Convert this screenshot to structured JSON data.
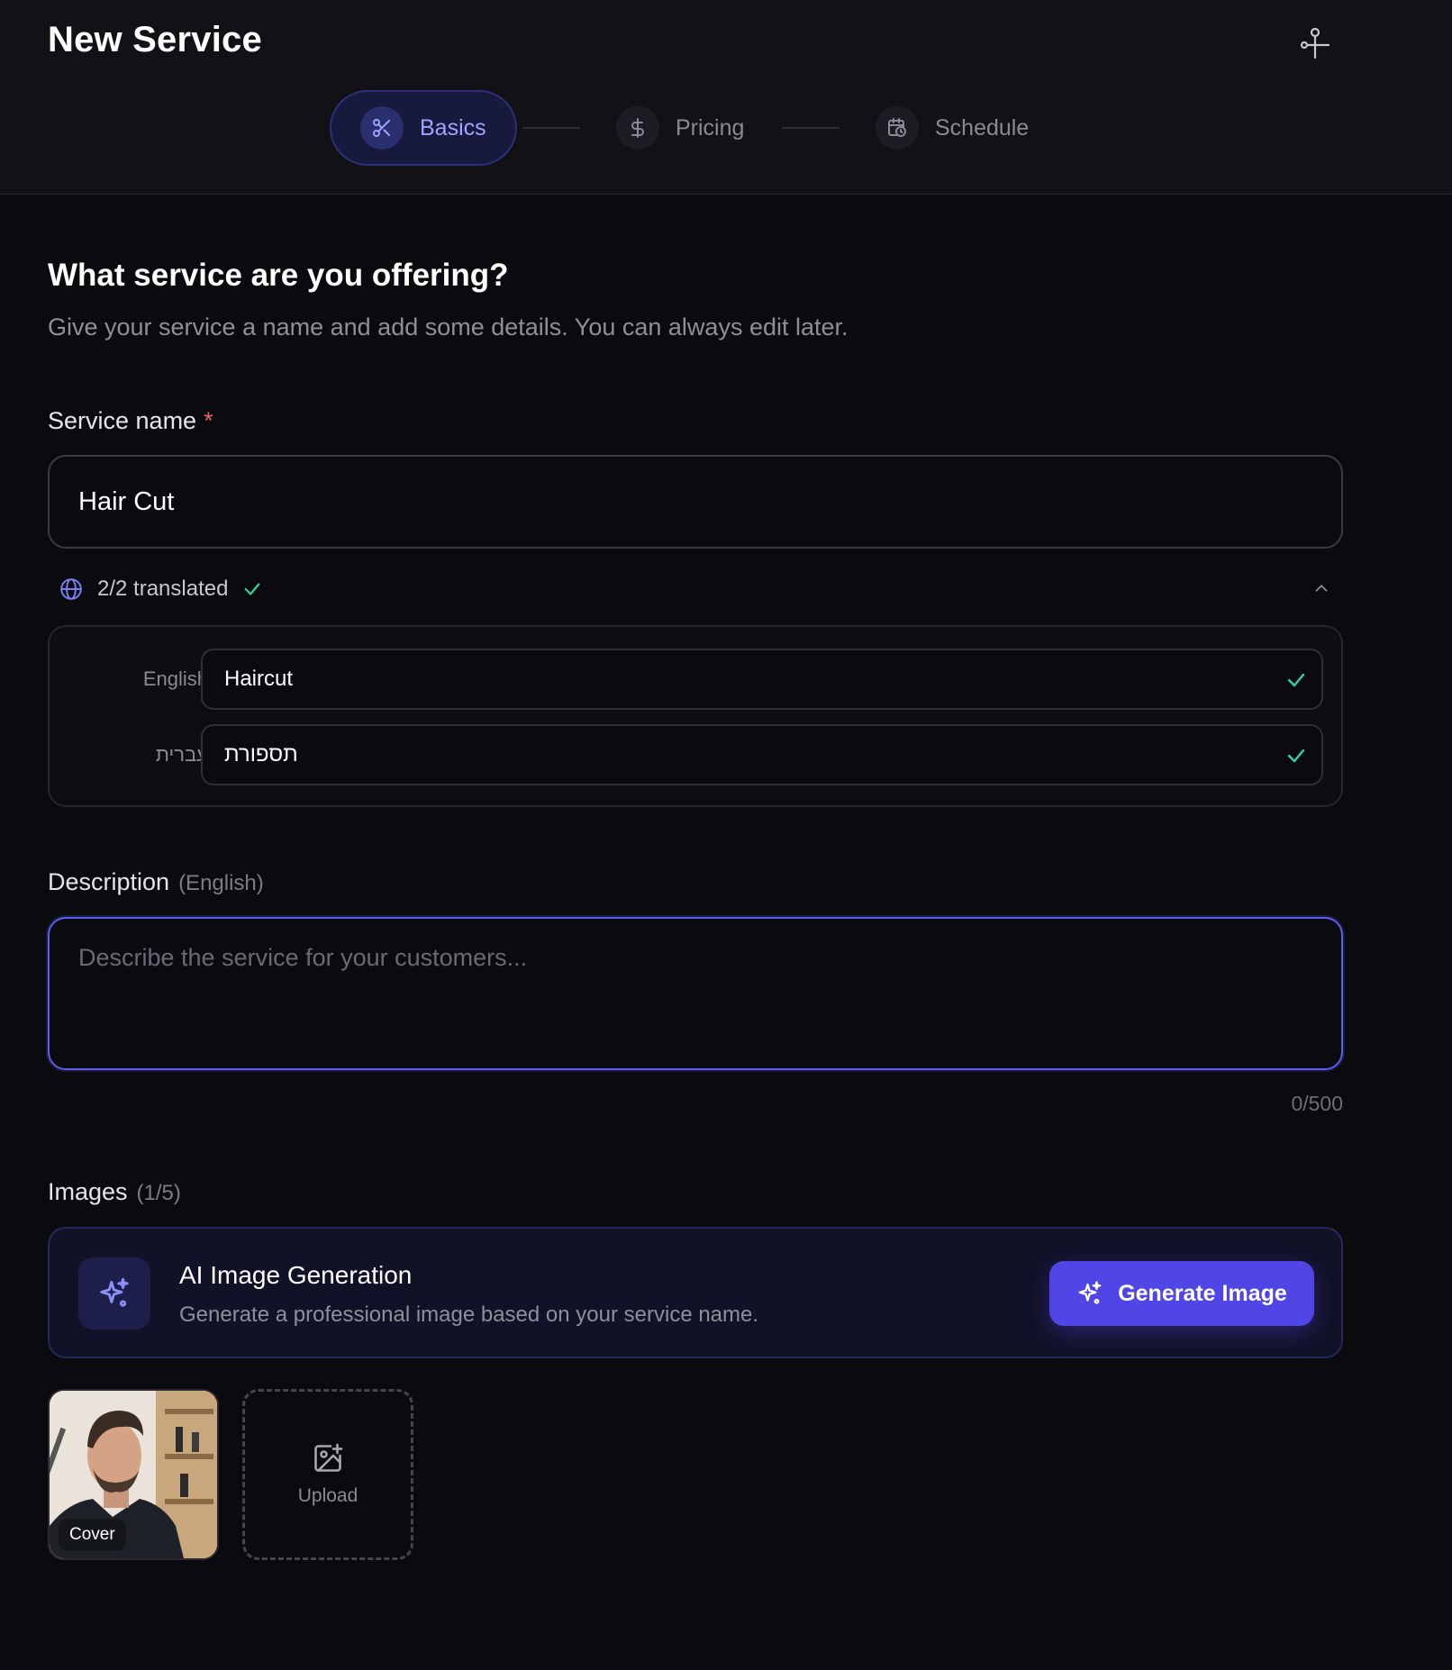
{
  "header": {
    "title": "New Service",
    "settings_icon": "pin-icon"
  },
  "steps": [
    {
      "label": "Basics",
      "icon": "scissors-icon",
      "active": true
    },
    {
      "label": "Pricing",
      "icon": "dollar-icon",
      "active": false
    },
    {
      "label": "Schedule",
      "icon": "calendar-clock-icon",
      "active": false
    }
  ],
  "intro": {
    "heading": "What service are you offering?",
    "subheading": "Give your service a name and add some details. You can always edit later."
  },
  "service_name": {
    "label": "Service name",
    "required_mark": "*",
    "value": "Hair Cut"
  },
  "translations": {
    "status": "2/2 translated",
    "rows": [
      {
        "language": "English",
        "value": "Haircut"
      },
      {
        "language": "עברית",
        "value": "תספורת"
      }
    ]
  },
  "description": {
    "label": "Description",
    "language_hint": "(English)",
    "placeholder": "Describe the service for your customers...",
    "counter": "0/500"
  },
  "images": {
    "label": "Images",
    "count": "(1/5)",
    "ai": {
      "title": "AI Image Generation",
      "description": "Generate a professional image based on your service name.",
      "button": "Generate Image"
    },
    "thumbnails": [
      {
        "badge": "Cover"
      }
    ],
    "upload_label": "Upload"
  },
  "colors": {
    "accent": "#4f46e5",
    "success": "#34d399",
    "required": "#f0635d"
  }
}
